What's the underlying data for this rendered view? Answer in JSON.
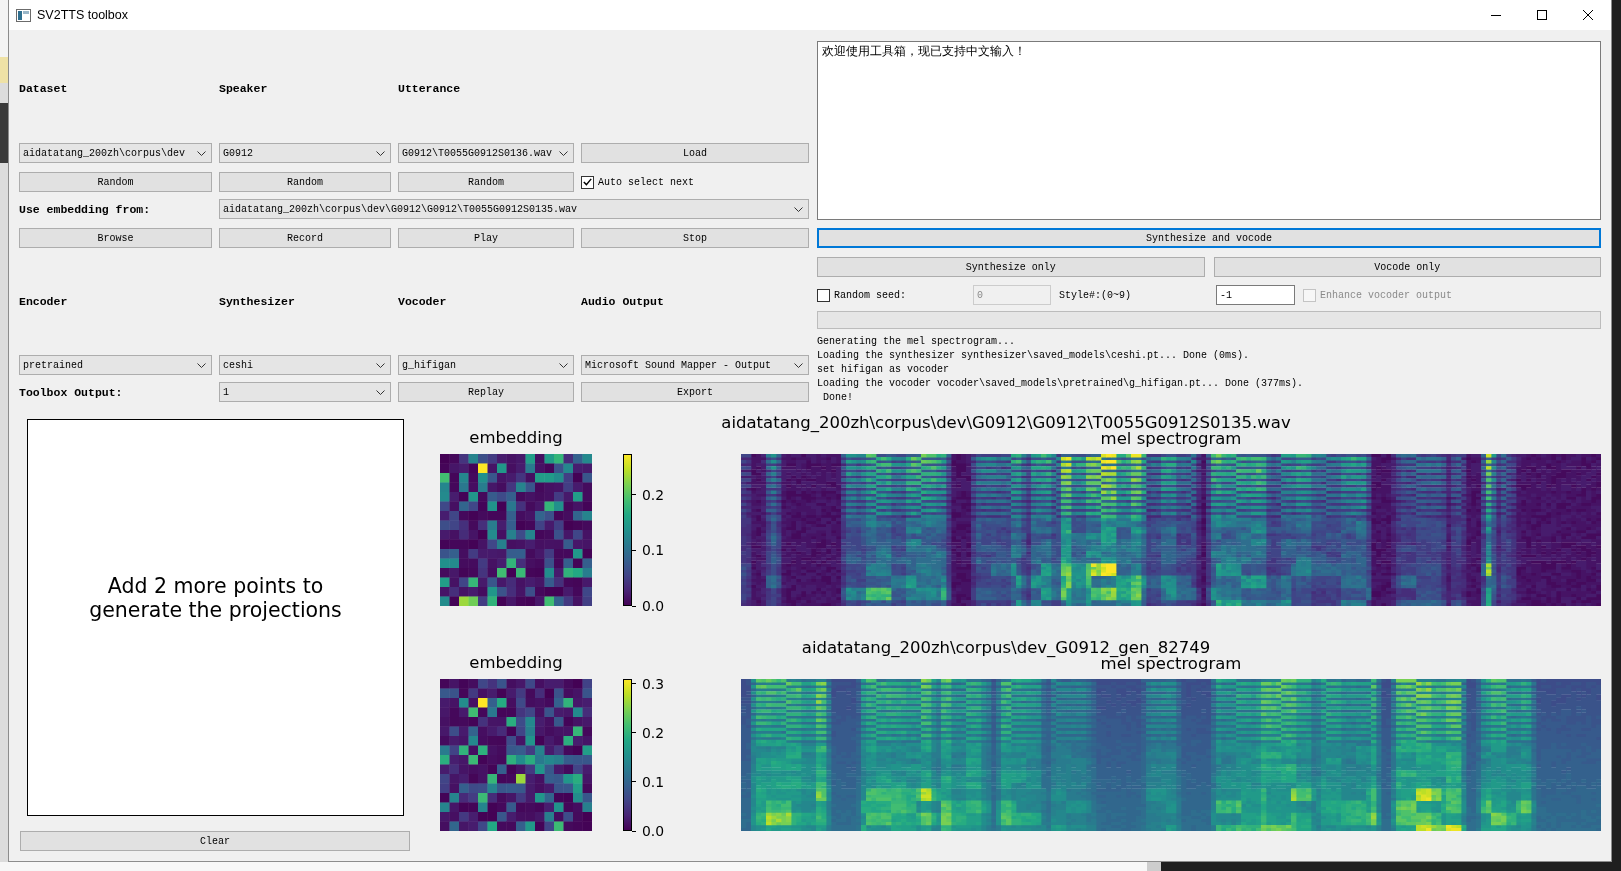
{
  "window": {
    "title": "SV2TTS toolbox"
  },
  "dataset_section": {
    "headers": [
      "Dataset",
      "Speaker",
      "Utterance"
    ],
    "dropdowns": [
      "aidatatang_200zh\\corpus\\dev",
      "G0912",
      "G0912\\T0055G0912S0136.wav"
    ],
    "load_button": "Load",
    "random_buttons": [
      "Random",
      "Random",
      "Random"
    ],
    "auto_select": {
      "label": "Auto select next",
      "checked": true
    },
    "embedding_label": "Use embedding from:",
    "embedding_dropdown": "aidatatang_200zh\\corpus\\dev\\G0912\\G0912\\T0055G0912S0135.wav",
    "buttons": [
      "Browse",
      "Record",
      "Play",
      "Stop"
    ]
  },
  "model_section": {
    "headers": [
      "Encoder",
      "Synthesizer",
      "Vocoder",
      "Audio Output"
    ],
    "dropdowns": [
      "pretrained",
      "ceshi",
      "g_hifigan",
      "Microsoft Sound Mapper - Output"
    ],
    "output_label": "Toolbox Output:",
    "output_dropdown": "1",
    "buttons": [
      "Replay",
      "Export"
    ]
  },
  "text_input": {
    "value": "欢迎使用工具箱，现已支持中文输入！"
  },
  "synthesis": {
    "buttons": [
      {
        "label": "Synthesize and vocode",
        "focused": true
      },
      {
        "label": "Synthesize only",
        "focused": false
      },
      {
        "label": "Vocode only",
        "focused": false
      }
    ],
    "random_seed": {
      "label": "Random seed:",
      "checked": false
    },
    "seed_field": {
      "value": "0",
      "disabled": true
    },
    "style": {
      "label": "Style#:(0~9)",
      "value": "-1"
    },
    "enhance": {
      "label": "Enhance vocoder output",
      "checked": false,
      "disabled": true
    },
    "progress": {
      "level": 0
    }
  },
  "log": [
    "Generating the mel spectrogram...",
    "Loading the synthesizer synthesizer\\saved_models\\ceshi.pt... Done (0ms).",
    "set hifigan as vocoder",
    "Loading the vocoder vocoder\\saved_models\\pretrained\\g_hifigan.pt... Done (377ms).",
    " Done!"
  ],
  "projections": {
    "message": "Add 2 more points to\ngenerate the projections",
    "clear_button": "Clear"
  },
  "plots": [
    {
      "title": "aidatatang_200zh\\corpus\\dev\\G0912\\G0912\\T0055G0912S0135.wav",
      "subtitle": "mel spectrogram",
      "embedding_title": "embedding",
      "colorbar_ticks": [
        "0.2",
        "0.1",
        "0.0"
      ]
    },
    {
      "title": "aidatatang_200zh\\corpus\\dev_G0912_gen_82749",
      "subtitle": "mel spectrogram",
      "embedding_title": "embedding",
      "colorbar_ticks": [
        "0.3",
        "0.2",
        "0.1",
        "0.0"
      ]
    }
  ]
}
